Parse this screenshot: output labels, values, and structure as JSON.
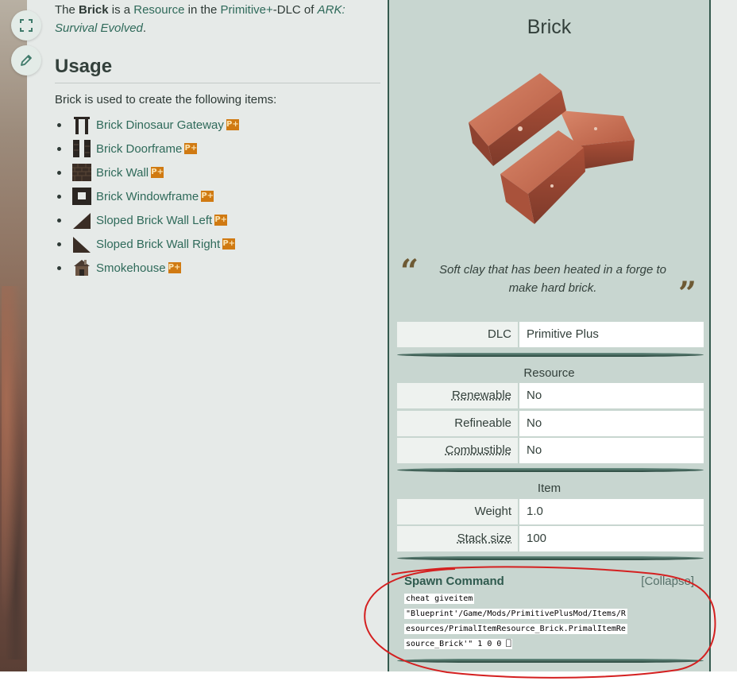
{
  "intro": {
    "the": "The",
    "name": "Brick",
    "is_a": "is a",
    "resource_link": "Resource",
    "in_the": "in the",
    "dlc_link": "Primitive+",
    "dlc_of": "-DLC of",
    "game": "ARK: Survival Evolved",
    "period": "."
  },
  "usage": {
    "heading": "Usage",
    "description": "Brick is used to create the following items:",
    "items": [
      {
        "label": "Brick Dinosaur Gateway",
        "icon": "gateway-icon",
        "badge": "P+"
      },
      {
        "label": "Brick Doorframe",
        "icon": "doorframe-icon",
        "badge": "P+"
      },
      {
        "label": "Brick Wall",
        "icon": "wall-icon",
        "badge": "P+"
      },
      {
        "label": "Brick Windowframe",
        "icon": "windowframe-icon",
        "badge": "P+"
      },
      {
        "label": "Sloped Brick Wall Left",
        "icon": "slope-left-icon",
        "badge": "P+"
      },
      {
        "label": "Sloped Brick Wall Right",
        "icon": "slope-right-icon",
        "badge": "P+"
      },
      {
        "label": "Smokehouse",
        "icon": "smokehouse-icon",
        "badge": "P+"
      }
    ]
  },
  "infobox": {
    "title": "Brick",
    "quote": "Soft clay that has been heated in a forge to make hard brick.",
    "dlc_label": "DLC",
    "dlc_value": "Primitive Plus",
    "resource_heading": "Resource",
    "renewable_label": "Renewable",
    "renewable_value": "No",
    "refineable_label": "Refineable",
    "refineable_value": "No",
    "combustible_label": "Combustible",
    "combustible_value": "No",
    "item_heading": "Item",
    "weight_label": "Weight",
    "weight_value": "1.0",
    "stack_label": "Stack size",
    "stack_value": "100"
  },
  "spawn": {
    "title": "Spawn Command",
    "collapse": "[Collapse]",
    "lines": [
      "cheat giveitem",
      "\"Blueprint'/Game/Mods/PrimitivePlusMod/Items/R",
      "esources/PrimalItemResource_Brick.PrimalItemRe",
      "source_Brick'\" 1 0 0  ⎕"
    ]
  },
  "colors": {
    "accent": "#2f6a5a",
    "infobox_bg": "#c8d6d0",
    "badge": "#d07a12",
    "annotation": "#d42020"
  },
  "toolbar": {
    "expand_icon": "expand-icon",
    "edit_icon": "pencil-icon"
  }
}
